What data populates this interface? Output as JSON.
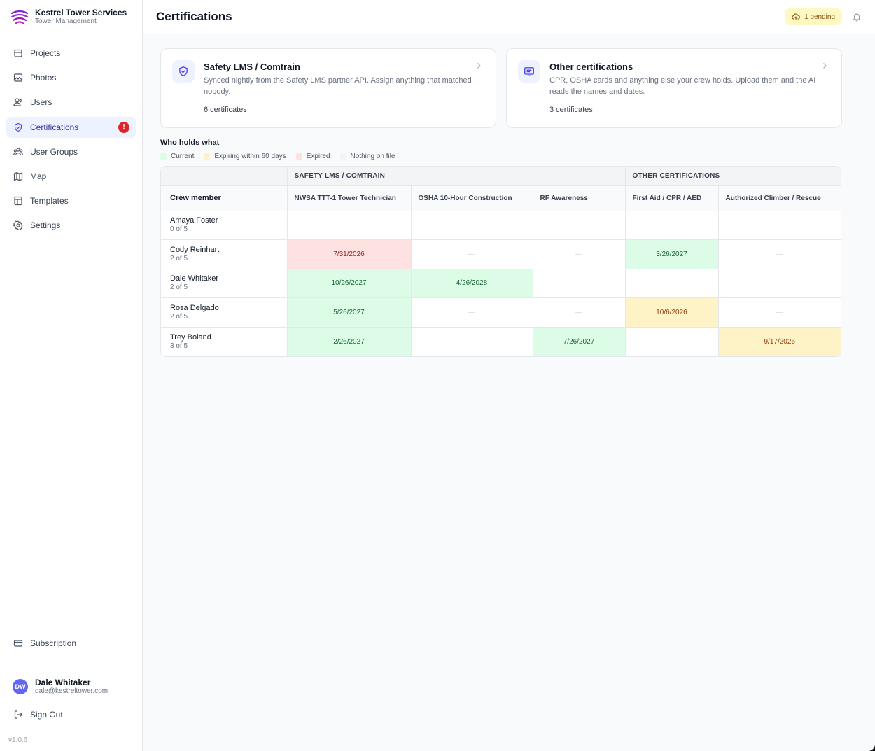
{
  "brand": {
    "name": "Kestrel Tower Services",
    "subtitle": "Tower Management"
  },
  "sidebar": {
    "items": [
      {
        "label": "Projects",
        "icon": "folder-icon"
      },
      {
        "label": "Photos",
        "icon": "image-icon"
      },
      {
        "label": "Users",
        "icon": "users-icon"
      },
      {
        "label": "Certifications",
        "icon": "shield-check-icon",
        "active": true,
        "badge": "!"
      },
      {
        "label": "User Groups",
        "icon": "user-groups-icon"
      },
      {
        "label": "Map",
        "icon": "map-icon"
      },
      {
        "label": "Templates",
        "icon": "template-icon"
      },
      {
        "label": "Settings",
        "icon": "gear-icon"
      }
    ],
    "subscription_label": "Subscription",
    "user": {
      "initials": "DW",
      "name": "Dale Whitaker",
      "email": "dale@kestreltower.com"
    },
    "signout_label": "Sign Out",
    "version": "v1.0.6"
  },
  "header": {
    "title": "Certifications",
    "pending_label": "1 pending"
  },
  "cards": [
    {
      "title": "Safety LMS / Comtrain",
      "description": "Synced nightly from the Safety LMS partner API. Assign anything that matched nobody.",
      "count": "6 certificates",
      "icon": "shield-check-icon"
    },
    {
      "title": "Other certifications",
      "description": "CPR, OSHA cards and anything else your crew holds. Upload them and the AI reads the names and dates.",
      "count": "3 certificates",
      "icon": "card-icon"
    }
  ],
  "matrix": {
    "title": "Who holds what",
    "legend": [
      {
        "label": "Current",
        "color": "#dcfce7"
      },
      {
        "label": "Expiring within 60 days",
        "color": "#fef3c7"
      },
      {
        "label": "Expired",
        "color": "#fee2e2"
      },
      {
        "label": "Nothing on file",
        "color": "#f3f4f6"
      }
    ],
    "groups": [
      {
        "label": "SAFETY LMS / COMTRAIN",
        "span": 3
      },
      {
        "label": "OTHER CERTIFICATIONS",
        "span": 2
      }
    ],
    "crew_header": "Crew member",
    "columns": [
      "NWSA TTT-1 Tower Technician",
      "OSHA 10-Hour Construction",
      "RF Awareness",
      "First Aid / CPR / AED",
      "Authorized Climber / Rescue"
    ],
    "empty_mark": "—",
    "rows": [
      {
        "name": "Amaya Foster",
        "count": "0 of 5",
        "cells": [
          {
            "status": "none",
            "value": ""
          },
          {
            "status": "none",
            "value": ""
          },
          {
            "status": "none",
            "value": ""
          },
          {
            "status": "none",
            "value": ""
          },
          {
            "status": "none",
            "value": ""
          }
        ]
      },
      {
        "name": "Cody Reinhart",
        "count": "2 of 5",
        "cells": [
          {
            "status": "expired",
            "value": "7/31/2026"
          },
          {
            "status": "none",
            "value": ""
          },
          {
            "status": "none",
            "value": ""
          },
          {
            "status": "current",
            "value": "3/26/2027"
          },
          {
            "status": "none",
            "value": ""
          }
        ]
      },
      {
        "name": "Dale Whitaker",
        "count": "2 of 5",
        "cells": [
          {
            "status": "current",
            "value": "10/26/2027"
          },
          {
            "status": "current",
            "value": "4/26/2028"
          },
          {
            "status": "none",
            "value": ""
          },
          {
            "status": "none",
            "value": ""
          },
          {
            "status": "none",
            "value": ""
          }
        ]
      },
      {
        "name": "Rosa Delgado",
        "count": "2 of 5",
        "cells": [
          {
            "status": "current",
            "value": "5/26/2027"
          },
          {
            "status": "none",
            "value": ""
          },
          {
            "status": "none",
            "value": ""
          },
          {
            "status": "expiring",
            "value": "10/6/2026"
          },
          {
            "status": "none",
            "value": ""
          }
        ]
      },
      {
        "name": "Trey Boland",
        "count": "3 of 5",
        "cells": [
          {
            "status": "current",
            "value": "2/26/2027"
          },
          {
            "status": "none",
            "value": ""
          },
          {
            "status": "current",
            "value": "7/26/2027"
          },
          {
            "status": "none",
            "value": ""
          },
          {
            "status": "expiring",
            "value": "9/17/2026"
          }
        ]
      }
    ]
  }
}
